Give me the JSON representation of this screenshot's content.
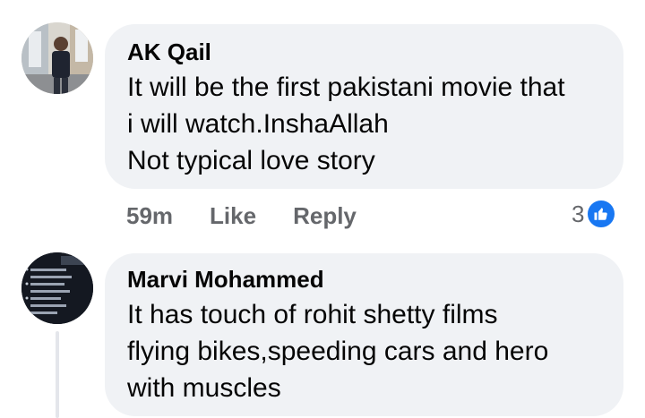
{
  "comments": [
    {
      "author": "AK Qail",
      "lines": [
        "It will be the first pakistani movie that",
        "i will watch.InshaAllah",
        "Not typical love story"
      ],
      "time": "59m",
      "like_label": "Like",
      "reply_label": "Reply",
      "reaction_count": "3",
      "reaction_icon": "like-thumb-icon"
    },
    {
      "author": "Marvi Mohammed",
      "lines": [
        "It has touch of rohit shetty films",
        "flying bikes,speeding cars and hero",
        "with muscles"
      ]
    }
  ],
  "colors": {
    "bubble_bg": "#f0f2f5",
    "text": "#050505",
    "meta": "#65676b",
    "like_blue": "#1877f2",
    "thread_line": "#e4e6eb"
  }
}
